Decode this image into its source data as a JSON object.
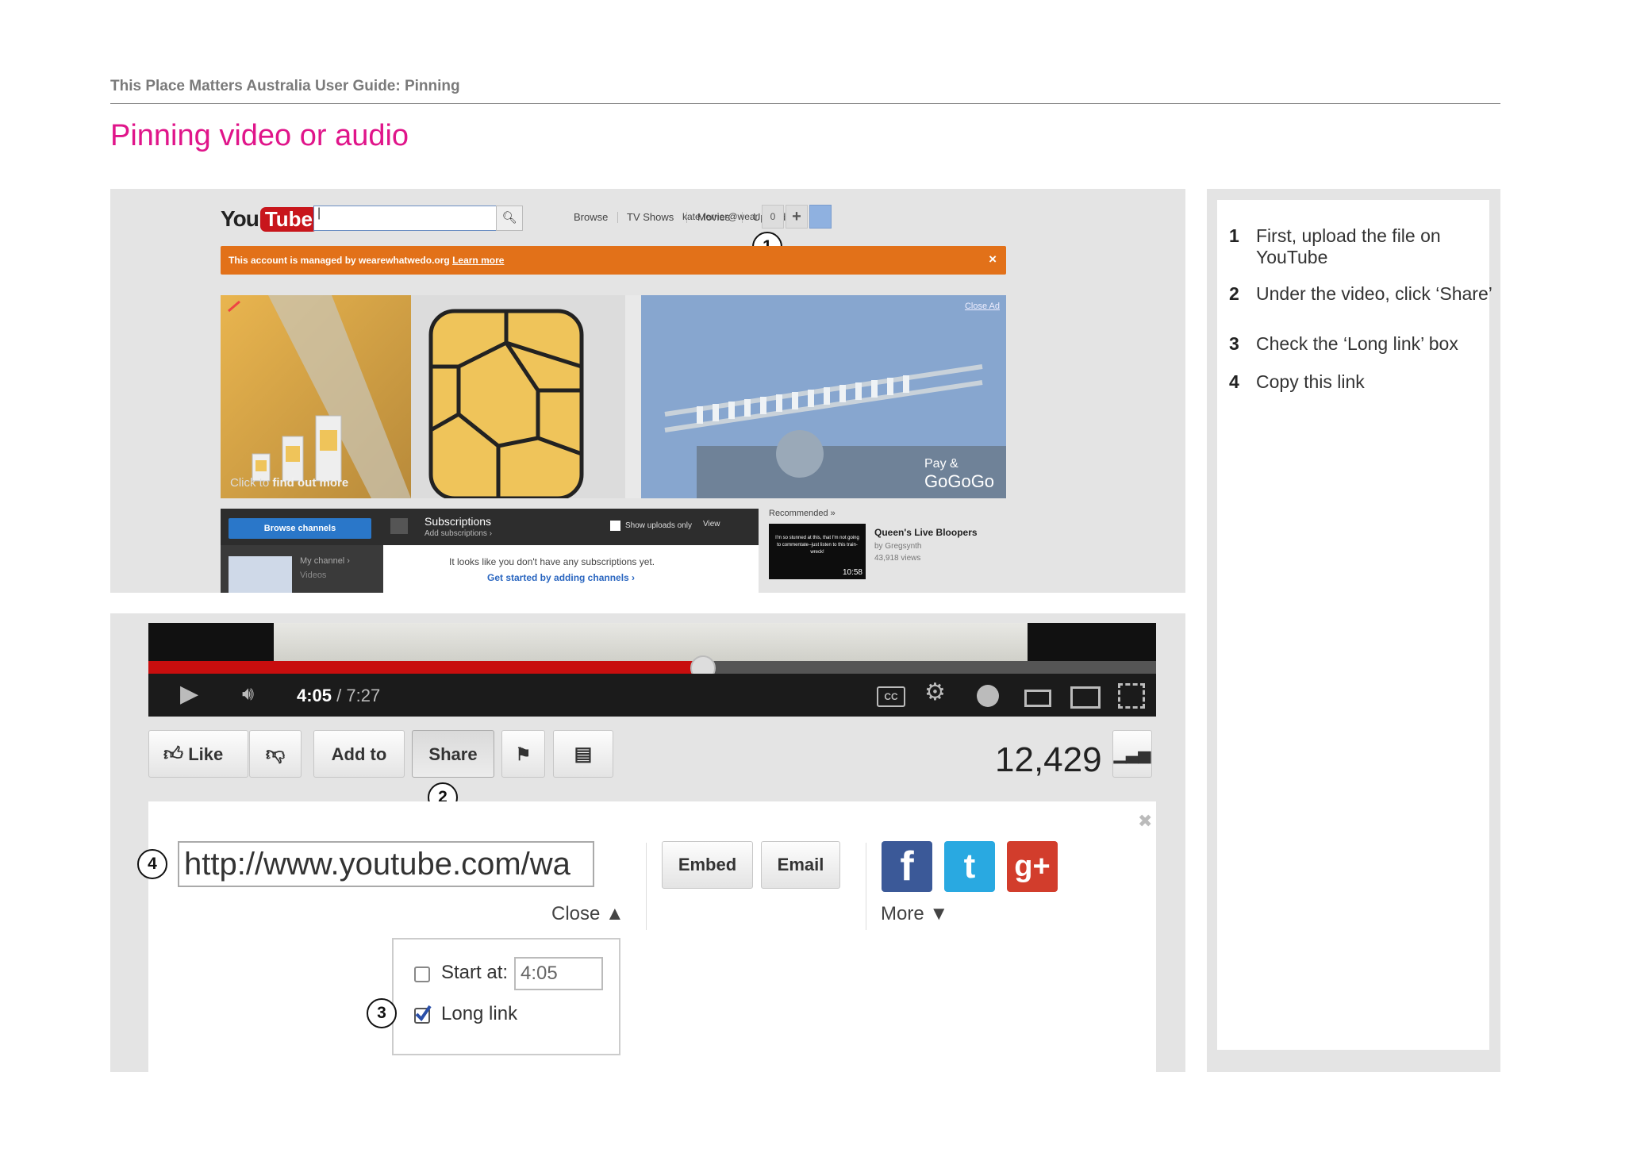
{
  "guide": {
    "header": "This Place Matters Australia User Guide: Pinning",
    "title": "Pinning video or audio"
  },
  "steps": [
    {
      "num": "1",
      "text": "First, upload the file on YouTube"
    },
    {
      "num": "2",
      "text": "Under the video, click ‘Share’"
    },
    {
      "num": "3",
      "text": "Check the ‘Long link’ box"
    },
    {
      "num": "4",
      "text": "Copy this link"
    }
  ],
  "markers": {
    "m1": "1",
    "m2": "2",
    "m3": "3",
    "m4": "4"
  },
  "youtube": {
    "logo_you": "You",
    "logo_tube": "Tube",
    "search_value": "|",
    "nav": [
      "Browse",
      "TV Shows",
      "Movies",
      "Upload"
    ],
    "account": "kate.ferrier@wear...",
    "notif_count": "0",
    "plus_label": "+",
    "banner_text": "This account is managed by wearewhatwedo.org",
    "banner_link": "Learn more",
    "banner_close": "×",
    "ad_close": "Close Ad",
    "ad_cta_prefix": "Click to",
    "ad_cta_bold": "find out more",
    "ad_brand_top": "Pay &",
    "ad_brand_bottom": "GoGoGo",
    "browse_channels": "Browse channels",
    "subs_title": "Subscriptions",
    "subs_sub": "Add subscriptions ›",
    "show_uploads": "Show uploads only",
    "view_label": "View",
    "my_channel": "My channel ›",
    "videos_label": "Videos",
    "empty_msg": "It looks like you don't have any subscriptions yet.",
    "get_started": "Get started by adding channels ›",
    "recommended": "Recommended »",
    "rec_thumb_text": "I'm so stunned at this, that I'm not going to commentate--just listen to this train-wreck!",
    "rec_duration": "10:58",
    "rec_title": "Queen's Live Bloopers",
    "rec_by": "by Gregsynth",
    "rec_views": "43,918 views"
  },
  "player": {
    "time_current": "4:05",
    "time_total": " / 7:27",
    "progress": 0.549,
    "cc_label": "CC"
  },
  "actions": {
    "like": "Like",
    "add_to": "Add to",
    "share": "Share",
    "views": "12,429"
  },
  "share": {
    "url": "http://www.youtube.com/wa",
    "close": "Close ▲",
    "embed": "Embed",
    "email": "Email",
    "facebook": "f",
    "twitter": "t",
    "gplus": "g+",
    "more": "More ▼",
    "start_at_label": "Start at:",
    "start_at_value": "4:05",
    "start_checked": false,
    "long_link_label": "Long link",
    "long_link_checked": true
  },
  "colors": {
    "title_pink": "#e0158a",
    "banner_orange": "#e27119",
    "progress_red": "#c80e0e",
    "facebook_blue": "#3b5998",
    "twitter_blue": "#29a9e1",
    "gplus_red": "#d23d2c"
  }
}
